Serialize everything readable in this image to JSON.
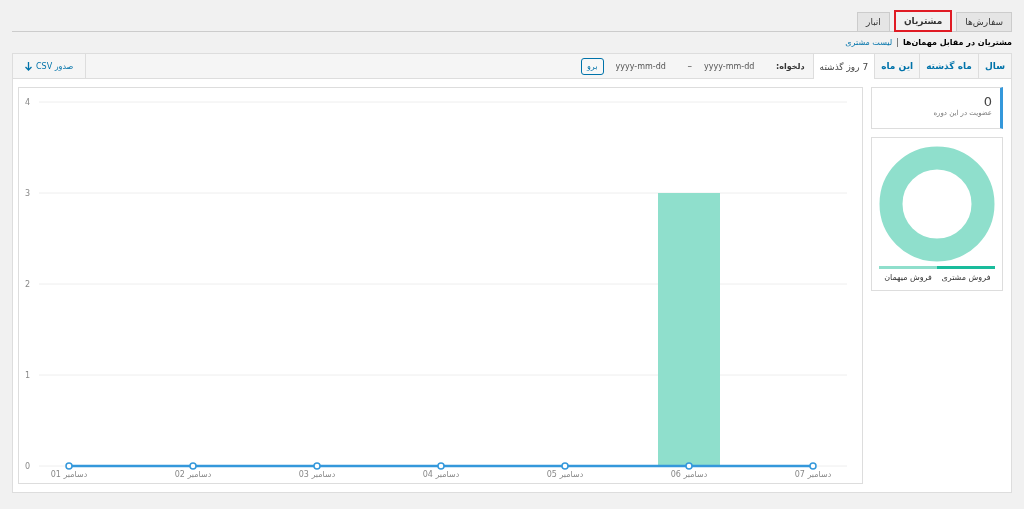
{
  "nav_tabs": [
    {
      "label": "سفارش‌ها",
      "selected": false,
      "highlighted": false
    },
    {
      "label": "مشتریان",
      "selected": true,
      "highlighted": true
    },
    {
      "label": "انبار",
      "selected": false,
      "highlighted": false
    }
  ],
  "subnav": [
    {
      "label": "مشتریان در مقابل مهمان‌ها",
      "selected": true
    },
    {
      "label": "لیست مشتری",
      "selected": false
    }
  ],
  "subnav_separator": "|",
  "ranges": [
    {
      "label": "سال",
      "selected": false
    },
    {
      "label": "ماه گذشته",
      "selected": false
    },
    {
      "label": "این ماه",
      "selected": false
    },
    {
      "label": "7 روز گذشته",
      "selected": true
    }
  ],
  "custom_range": {
    "label": "دلخواه:",
    "from_placeholder": "yyyy-mm-dd",
    "separator": "–",
    "to_placeholder": "yyyy-mm-dd",
    "button": "برو"
  },
  "export": {
    "label": "صدور CSV"
  },
  "summary": {
    "value": "0",
    "caption": "عضویت در این دوره"
  },
  "legend": [
    {
      "label": "فروش مشتری",
      "color": "#1abc9c"
    },
    {
      "label": "فروش میهمان",
      "color": "#8fdfcc"
    }
  ],
  "chart_data": {
    "type": "bar",
    "categories": [
      "01 دسامبر",
      "02 دسامبر",
      "03 دسامبر",
      "04 دسامبر",
      "05 دسامبر",
      "06 دسامبر",
      "07 دسامبر"
    ],
    "series": [
      {
        "color": "#8fdfcc",
        "values": [
          0,
          0,
          0,
          0,
          0,
          3,
          0
        ]
      },
      {
        "color": "#3498db",
        "values": [
          0,
          0,
          0,
          0,
          0,
          0,
          0
        ]
      }
    ],
    "ylim": [
      0,
      4
    ],
    "yticks": [
      0,
      1,
      2,
      3,
      4
    ],
    "grid": true
  }
}
